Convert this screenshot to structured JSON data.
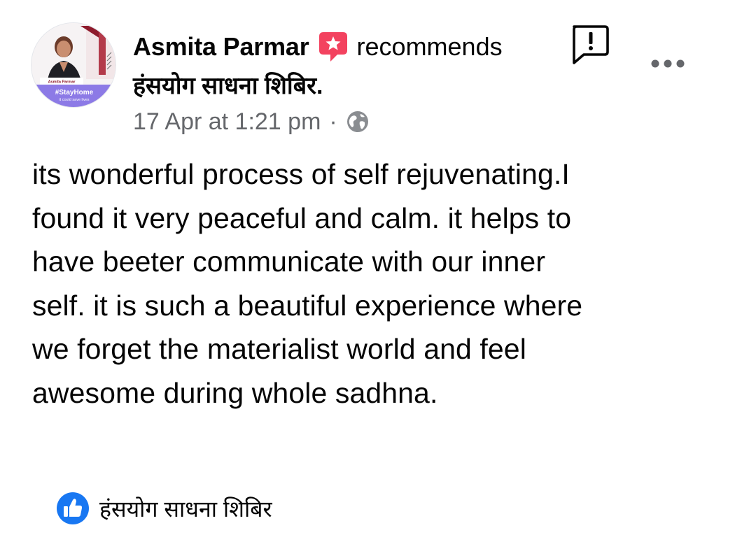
{
  "post": {
    "author": {
      "name": "Asmita Parmar",
      "avatar_badge_name": "Asmita Parmar",
      "avatar_tag": "#StayHome",
      "avatar_tag_sub": "it could save lives"
    },
    "action_text": "recommends",
    "page_name": "हंसयोग साधना शिबिर.",
    "timestamp": "17 Apr at 1:21 pm",
    "separator": "·",
    "privacy_icon": "globe-icon",
    "body": "its wonderful process of self rejuvenating.I\nfound it very peaceful and calm. it helps to\nhave beeter communicate with our inner\nself. it is such a beautiful experience where\nwe forget the materialist world and feel\nawesome during whole sadhna.",
    "page_link_label": "हंसयोग साधना शिबिर"
  },
  "icons": {
    "recommend": "recommend-icon",
    "report": "report-icon",
    "more": "more-options-icon",
    "like": "like-icon"
  },
  "colors": {
    "recommend_red": "#f3425f",
    "like_blue": "#1877f2",
    "secondary_text": "#65676b",
    "avatar_tag_purple": "#8c7ae6"
  }
}
